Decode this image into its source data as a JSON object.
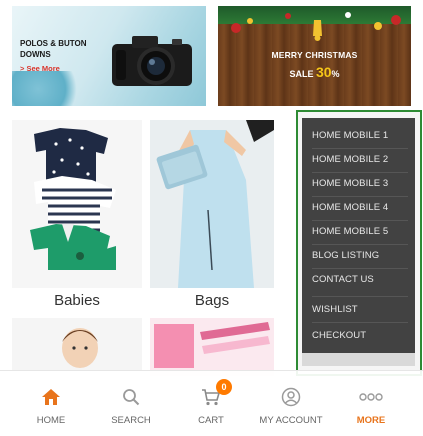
{
  "banners": {
    "left": {
      "title": "POLOS & BUTON DOWNS",
      "cta": "> See More"
    },
    "right": {
      "headline": "MERRY CHRISTMAS",
      "sale_label": "SALE",
      "sale_value": "30",
      "sale_unit": "%"
    }
  },
  "tiles": [
    {
      "label": "Babies"
    },
    {
      "label": "Bags"
    }
  ],
  "menu": {
    "items": [
      "HOME MOBILE 1",
      "HOME MOBILE 2",
      "HOME MOBILE 3",
      "HOME MOBILE 4",
      "HOME MOBILE 5",
      "BLOG LISTING",
      "CONTACT US",
      "WISHLIST",
      "CHECKOUT"
    ]
  },
  "bottom_nav": {
    "items": [
      {
        "label": "HOME",
        "icon": "home-icon"
      },
      {
        "label": "SEARCH",
        "icon": "search-icon"
      },
      {
        "label": "CART",
        "icon": "cart-icon"
      },
      {
        "label": "MY ACCOUNT",
        "icon": "account-icon"
      },
      {
        "label": "MORE",
        "icon": "more-icon"
      }
    ],
    "cart_count": "0"
  },
  "colors": {
    "accent": "#e8741c",
    "menu_bg": "#424242",
    "menu_border": "#2e8b34",
    "badge": "#ff7a00"
  }
}
